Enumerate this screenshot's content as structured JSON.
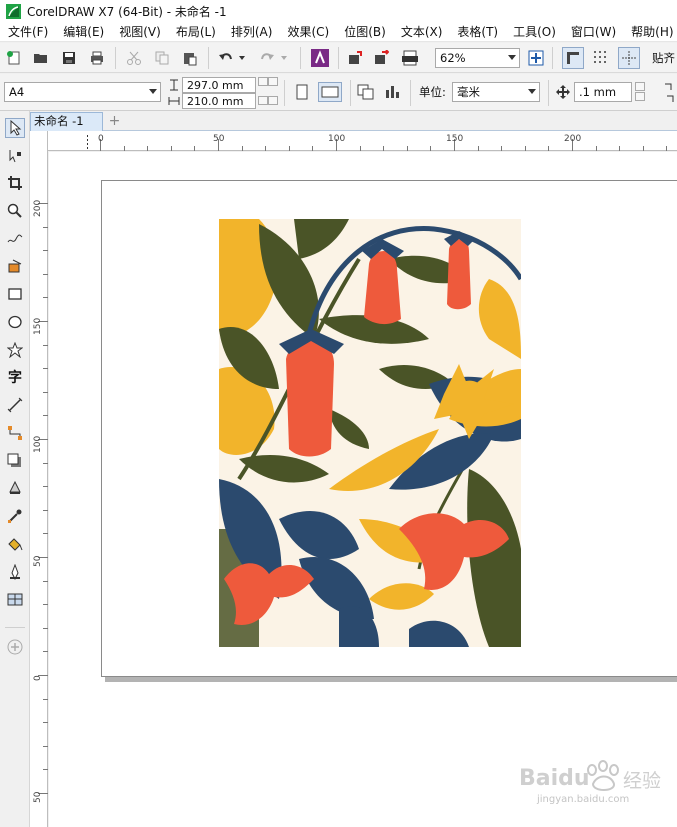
{
  "window": {
    "title": "CorelDRAW X7 (64-Bit) - 未命名 -1"
  },
  "menu": [
    "文件(F)",
    "编辑(E)",
    "视图(V)",
    "布局(L)",
    "排列(A)",
    "效果(C)",
    "位图(B)",
    "文本(X)",
    "表格(T)",
    "工具(O)",
    "窗口(W)",
    "帮助(H)"
  ],
  "toolbar": {
    "zoom": "62%",
    "snap_label": "贴齐"
  },
  "property_bar": {
    "page_size": "A4",
    "width": "297.0 mm",
    "height": "210.0 mm",
    "unit_label": "单位:",
    "unit": "毫米",
    "nudge": ".1 mm"
  },
  "document": {
    "tab_name": "未命名 -1",
    "add_tab": "+"
  },
  "rulers": {
    "horizontal": [
      "0",
      "50",
      "100",
      "150",
      "200"
    ],
    "vertical": [
      "200",
      "150",
      "100",
      "50",
      "0",
      "50"
    ]
  },
  "watermark": {
    "brand": "Baidu",
    "brand_cn": "经验",
    "url": "jingyan.baidu.com"
  },
  "colors": {
    "cream": "#fbf3e6",
    "orange": "#ee5a3c",
    "yellow": "#f2b42b",
    "navy": "#2b4a6e",
    "olive": "#4a5427",
    "accent_green": "#1fa345",
    "accent_purple": "#7a2a86"
  }
}
